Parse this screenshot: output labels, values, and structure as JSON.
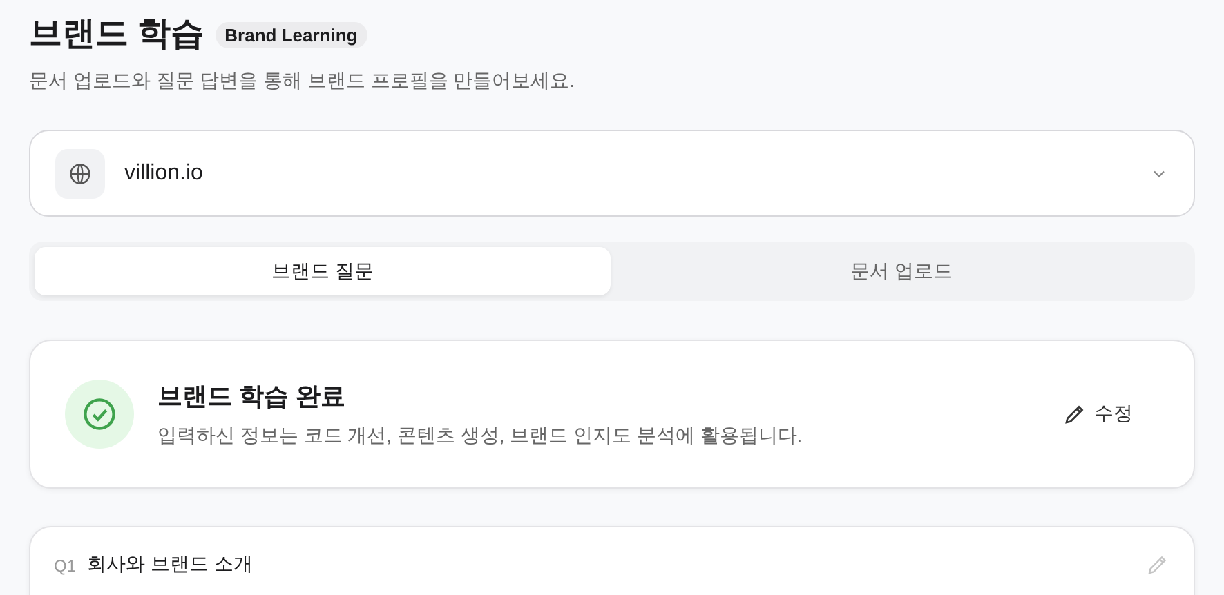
{
  "header": {
    "title": "브랜드 학습",
    "badge": "Brand Learning",
    "subtitle": "문서 업로드와 질문 답변을 통해 브랜드 프로필을 만들어보세요."
  },
  "site_select": {
    "value": "villion.io"
  },
  "tabs": [
    {
      "label": "브랜드 질문",
      "selected": true
    },
    {
      "label": "문서 업로드",
      "selected": false
    }
  ],
  "status_card": {
    "title": "브랜드 학습 완료",
    "description": "입력하신 정보는 코드 개선, 콘텐츠 생성, 브랜드 인지도 분석에 활용됩니다.",
    "edit_label": "수정"
  },
  "questions": [
    {
      "number": "Q1",
      "title": "회사와 브랜드 소개"
    }
  ]
}
